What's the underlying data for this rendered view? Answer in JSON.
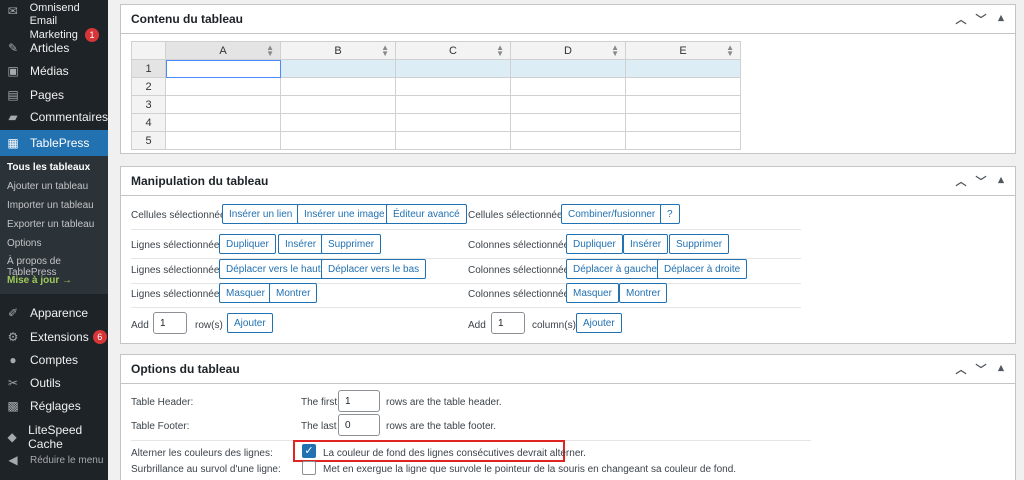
{
  "sidebar": {
    "items": [
      {
        "icon": "envelope-icon",
        "glyph": "✉",
        "label": "Omnisend Email",
        "label2": "Marketing",
        "badge": "1"
      },
      {
        "icon": "pin-icon",
        "glyph": "✎",
        "label": "Articles"
      },
      {
        "icon": "media-icon",
        "glyph": "▣",
        "label": "Médias"
      },
      {
        "icon": "page-icon",
        "glyph": "▤",
        "label": "Pages"
      },
      {
        "icon": "comment-icon",
        "glyph": "▰",
        "label": "Commentaires"
      },
      {
        "icon": "table-icon",
        "glyph": "▦",
        "label": "TablePress"
      },
      {
        "icon": "brush-icon",
        "glyph": "✐",
        "label": "Apparence"
      },
      {
        "icon": "plugin-icon",
        "glyph": "⚙",
        "label": "Extensions",
        "badge": "6"
      },
      {
        "icon": "user-icon",
        "glyph": "●",
        "label": "Comptes"
      },
      {
        "icon": "wrench-icon",
        "glyph": "✂",
        "label": "Outils"
      },
      {
        "icon": "settings-icon",
        "glyph": "▩",
        "label": "Réglages"
      },
      {
        "icon": "litespeed-icon",
        "glyph": "◆",
        "label": "LiteSpeed Cache"
      },
      {
        "icon": "collapse-icon",
        "glyph": "◀",
        "label": "Réduire le menu"
      }
    ],
    "submenu": [
      "Tous les tableaux",
      "Ajouter un tableau",
      "Importer un tableau",
      "Exporter un tableau",
      "Options",
      "À propos de TablePress",
      "Mise à jour →"
    ]
  },
  "content_box": {
    "title": "Contenu du tableau",
    "columns": [
      "A",
      "B",
      "C",
      "D",
      "E"
    ],
    "rows": [
      "1",
      "2",
      "3",
      "4",
      "5"
    ]
  },
  "manipulation": {
    "title": "Manipulation du tableau",
    "cells_label": "Cellules sélectionnées:",
    "lines_label": "Lignes sélectionnées:",
    "cols_label": "Colonnes sélectionnées:",
    "insert_link": "Insérer un lien",
    "insert_image": "Insérer une image",
    "advanced_editor": "Éditeur avancé",
    "merge": "Combiner/fusionner",
    "help": "?",
    "duplicate": "Dupliquer",
    "insert": "Insérer",
    "delete": "Supprimer",
    "move_up": "Déplacer vers le haut",
    "move_down": "Déplacer vers le bas",
    "move_left": "Déplacer à gauche",
    "move_right": "Déplacer à droite",
    "hide": "Masquer",
    "show": "Montrer",
    "add_label": "Add",
    "rows_value": "1",
    "rows_unit": "row(s)",
    "cols_value": "1",
    "cols_unit": "column(s)",
    "add_button": "Ajouter"
  },
  "options": {
    "title": "Options du tableau",
    "header_label": "Table Header:",
    "header_prefix": "The first",
    "header_value": "1",
    "header_suffix": "rows are the table header.",
    "footer_label": "Table Footer:",
    "footer_prefix": "The last",
    "footer_value": "0",
    "footer_suffix": "rows are the table footer.",
    "alternate_label": "Alterner les couleurs des lignes:",
    "alternate_text": "La couleur de fond des lignes consécutives devrait alterner.",
    "alternate_checked": true,
    "hover_label": "Surbrillance au survol d'une ligne:",
    "hover_text": "Met en exergue la ligne que survole le pointeur de la souris en changeant sa couleur de fond.",
    "hover_checked": false
  },
  "colors": {
    "accent": "#2271b1",
    "sidebar": "#1d2327",
    "highlight": "#e02424"
  }
}
